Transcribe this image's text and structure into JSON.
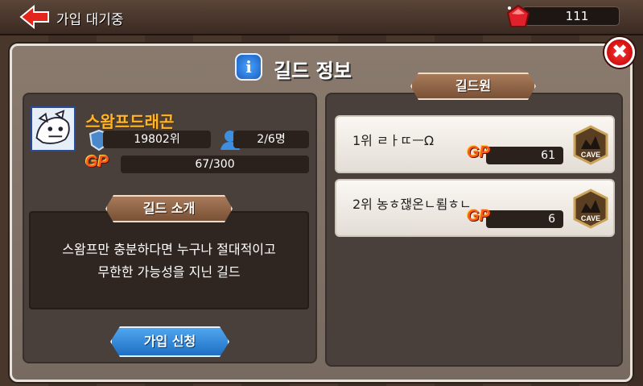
{
  "topbar": {
    "title": "가입 대기중",
    "gems": "111"
  },
  "dialog": {
    "title": "길드 정보",
    "info_icon_glyph": "i",
    "close_glyph": "✖"
  },
  "guild": {
    "name": "스왐프드래곤",
    "rank": "19802위",
    "members": "2/6명",
    "gp_label": "GP",
    "gp_value": "67/300",
    "intro_tab": "길드 소개",
    "description_line1": "스왐프만 충분하다면 누구나 절대적이고",
    "description_line2": "무한한 가능성을 지닌 길드",
    "join_button": "가입 신청"
  },
  "members_panel": {
    "tab": "길드원",
    "members": [
      {
        "name": "1위 ㄹㅏㄸㅡΩ",
        "gp_label": "GP",
        "gp": "61",
        "badge": "CAVE"
      },
      {
        "name": "2위 농ㅎ잲온ㄴ룀ㅎㄴ",
        "gp_label": "GP",
        "gp": "6",
        "badge": "CAVE"
      }
    ]
  },
  "icons": {
    "back": "back-arrow-icon",
    "gem": "ruby-gem-icon",
    "rank": "shield-rank-icon",
    "members": "user-icon",
    "cave": "cave-badge-icon"
  },
  "colors": {
    "guild_name": "#ffb52a",
    "join_button": "#2f86d8",
    "close_button": "#dd1111",
    "gp": "#ff5a1a"
  }
}
